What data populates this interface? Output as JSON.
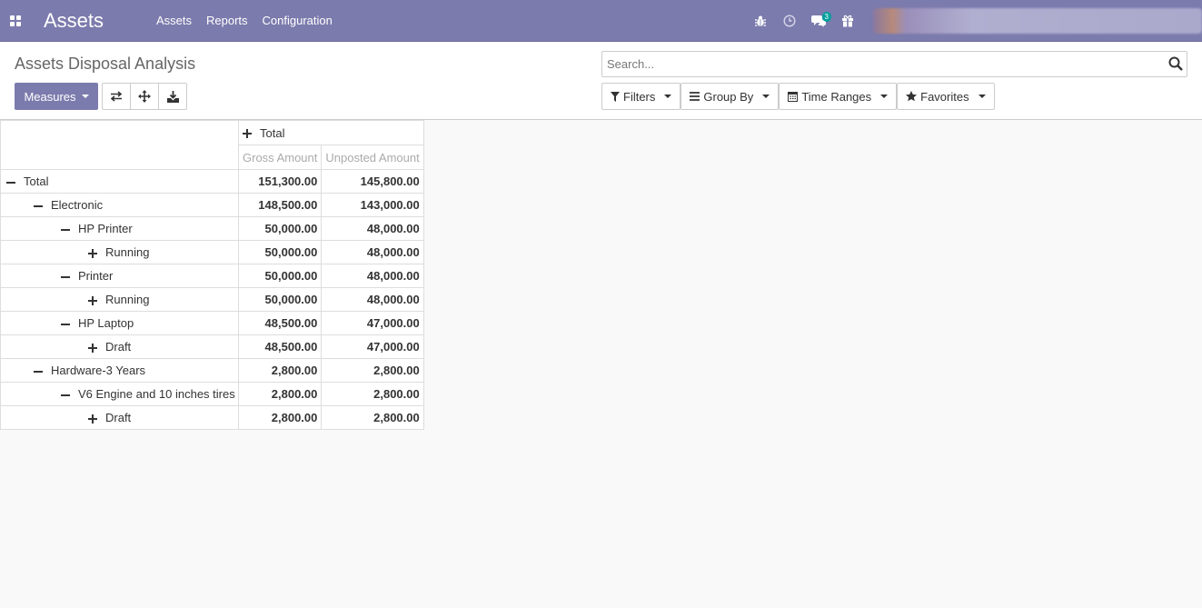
{
  "navbar": {
    "brand": "Assets",
    "menu": [
      "Assets",
      "Reports",
      "Configuration"
    ],
    "messages_badge": "3",
    "accent_color": "#7c7bad"
  },
  "control_panel": {
    "title": "Assets Disposal Analysis",
    "measures_label": "Measures",
    "search_placeholder": "Search...",
    "filters": [
      "Filters",
      "Group By",
      "Time Ranges",
      "Favorites"
    ]
  },
  "pivot": {
    "column_header": "Total",
    "measures": [
      "Gross Amount",
      "Unposted Amount"
    ],
    "rows": [
      {
        "label": "Total",
        "level": 0,
        "expanded": true,
        "gross": "151,300.00",
        "unposted": "145,800.00"
      },
      {
        "label": "Electronic",
        "level": 1,
        "expanded": true,
        "gross": "148,500.00",
        "unposted": "143,000.00"
      },
      {
        "label": "HP Printer",
        "level": 2,
        "expanded": true,
        "gross": "50,000.00",
        "unposted": "48,000.00"
      },
      {
        "label": "Running",
        "level": 3,
        "expanded": false,
        "gross": "50,000.00",
        "unposted": "48,000.00"
      },
      {
        "label": "Printer",
        "level": 2,
        "expanded": true,
        "gross": "50,000.00",
        "unposted": "48,000.00"
      },
      {
        "label": "Running",
        "level": 3,
        "expanded": false,
        "gross": "50,000.00",
        "unposted": "48,000.00"
      },
      {
        "label": "HP Laptop",
        "level": 2,
        "expanded": true,
        "gross": "48,500.00",
        "unposted": "47,000.00"
      },
      {
        "label": "Draft",
        "level": 3,
        "expanded": false,
        "gross": "48,500.00",
        "unposted": "47,000.00"
      },
      {
        "label": "Hardware-3 Years",
        "level": 1,
        "expanded": true,
        "gross": "2,800.00",
        "unposted": "2,800.00"
      },
      {
        "label": "V6 Engine and 10 inches tires",
        "level": 2,
        "expanded": true,
        "gross": "2,800.00",
        "unposted": "2,800.00"
      },
      {
        "label": "Draft",
        "level": 3,
        "expanded": false,
        "gross": "2,800.00",
        "unposted": "2,800.00"
      }
    ]
  }
}
